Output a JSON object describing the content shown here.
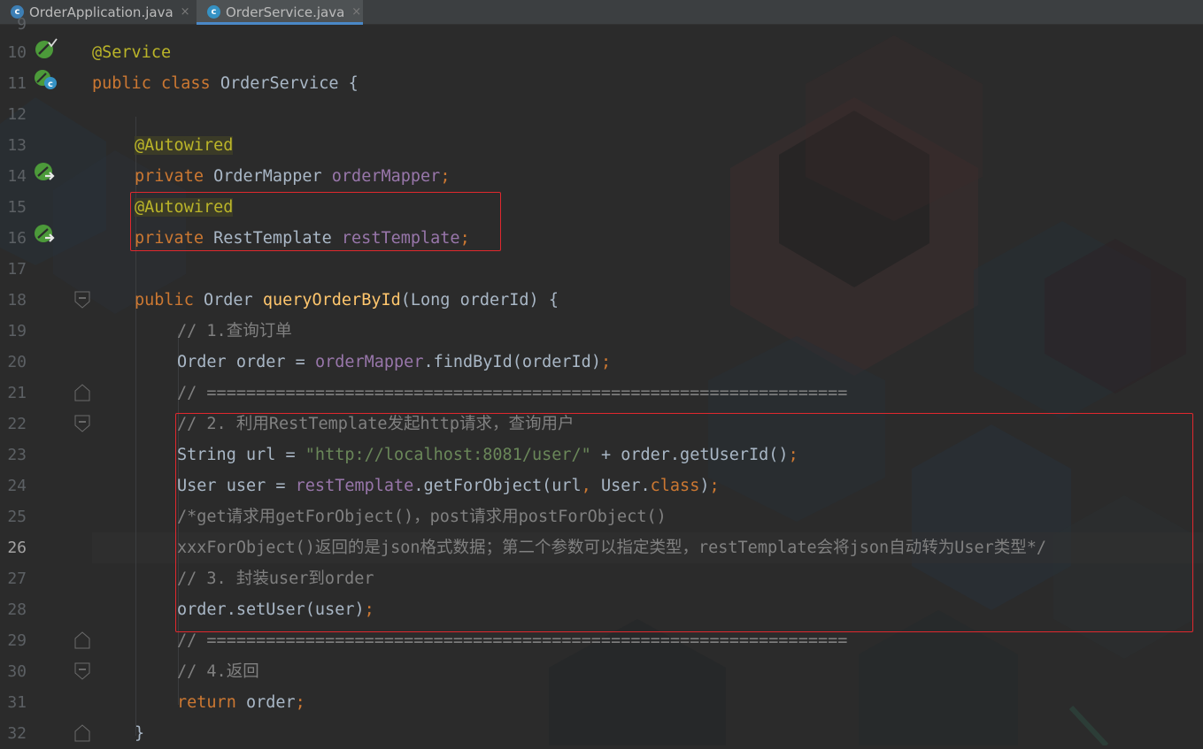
{
  "tabs": [
    {
      "label": "OrderApplication.java",
      "icon": "spring-app-class-icon",
      "close": "×",
      "active": false
    },
    {
      "label": "OrderService.java",
      "icon": "java-class-icon",
      "close": "×",
      "active": true
    }
  ],
  "tab_icon_letter": "c",
  "colors": {
    "keyword": "#cc7832",
    "annotation": "#bbb529",
    "field": "#9876aa",
    "method": "#ffc66d",
    "string": "#6a8759",
    "comment": "#808080",
    "text": "#a9b7c6",
    "highlight_box": "#e0282e",
    "background": "#2b2b2b"
  },
  "editor": {
    "partial_line_number": "9",
    "current_line": "26",
    "line_numbers": [
      "10",
      "11",
      "12",
      "13",
      "14",
      "15",
      "16",
      "17",
      "18",
      "19",
      "20",
      "21",
      "22",
      "23",
      "24",
      "25",
      "26",
      "27",
      "28",
      "29",
      "30",
      "31",
      "32"
    ],
    "code": {
      "l10": {
        "annotation": "@Service"
      },
      "l11": {
        "kw1": "public",
        "kw2": "class",
        "name": "OrderService",
        "brace": "{"
      },
      "l13": {
        "annotation": "@Autowired"
      },
      "l14": {
        "kw": "private",
        "type": "OrderMapper",
        "field": "orderMapper",
        "semi": ";"
      },
      "l15": {
        "annotation": "@Autowired"
      },
      "l16": {
        "kw": "private",
        "type": "RestTemplate",
        "field": "restTemplate",
        "semi": ";"
      },
      "l18": {
        "kw": "public",
        "type": "Order",
        "method": "queryOrderById",
        "params": "(Long orderId) {"
      },
      "l19": {
        "comment": "// 1.查询订单"
      },
      "l20": {
        "text1": "Order order = ",
        "field": "orderMapper",
        "text2": ".findById(orderId)",
        "semi": ";"
      },
      "l21": {
        "comment": "// ================================================================="
      },
      "l22": {
        "comment": "// 2. 利用RestTemplate发起http请求，查询用户"
      },
      "l23": {
        "text1": "String url = ",
        "string": "\"http://localhost:8081/user/\"",
        "text2": " + order.getUserId()",
        "semi": ";"
      },
      "l24": {
        "text1": "User user = ",
        "field": "restTemplate",
        "text2": ".getForObject(url",
        "comma": ",",
        "text3": " User.",
        "kw": "class",
        "text4": ")",
        "semi": ";"
      },
      "l25": {
        "comment": "/*get请求用getForObject()，post请求用postForObject()"
      },
      "l26": {
        "comment": "xxxForObject()返回的是json格式数据；第二个参数可以指定类型，restTemplate会将json自动转为User类型*/"
      },
      "l27": {
        "comment": "// 3. 封装user到order"
      },
      "l28": {
        "text": "order.setUser(user)",
        "semi": ";"
      },
      "l29": {
        "comment": "// ================================================================="
      },
      "l30": {
        "comment": "// 4.返回"
      },
      "l31": {
        "kw": "return",
        "text": " order",
        "semi": ";"
      },
      "l32": {
        "brace": "}"
      }
    }
  },
  "gutter_icons": [
    {
      "line": "10",
      "icon": "spring-bean-icon"
    },
    {
      "line": "11",
      "icon": "spring-bean-class-icon"
    },
    {
      "line": "14",
      "icon": "autowired-navigate-icon"
    },
    {
      "line": "16",
      "icon": "autowired-navigate-icon"
    }
  ]
}
